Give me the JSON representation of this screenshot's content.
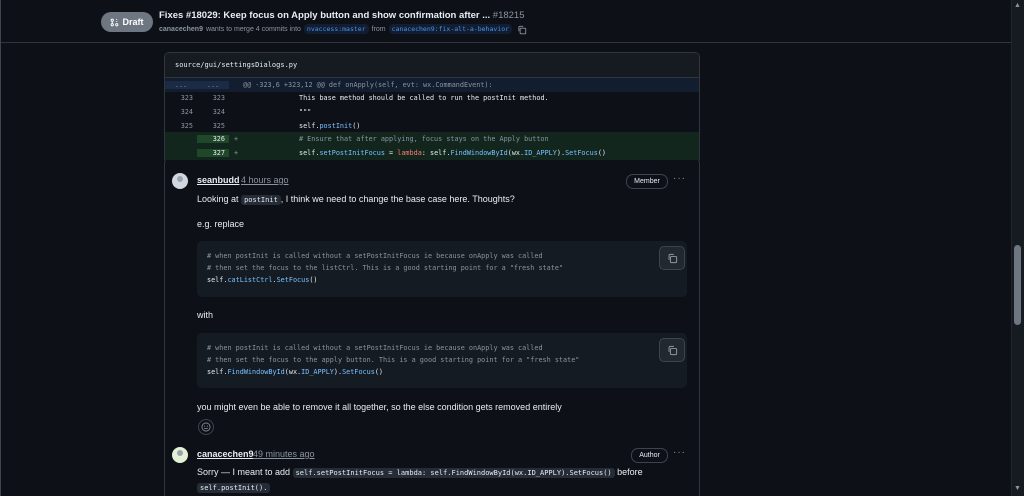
{
  "header": {
    "draft_label": "Draft",
    "title": "Fixes #18029: Keep focus on Apply button and show confirmation after ...",
    "number": "#18215",
    "author": "canacechen9",
    "merge_text": "wants to merge 4 commits into",
    "base_branch": "nvaccess:master",
    "from_text": "from",
    "head_branch": "canacechen9:fix-alt-a-behavior"
  },
  "file": {
    "path": "source/gui/settingsDialogs.py",
    "hunk": {
      "left": "...",
      "right": "...",
      "text": "@@ -323,6 +323,12 @@ def onApply(self, evt: wx.CommandEvent):"
    },
    "lines": [
      {
        "old": "323",
        "new": "323",
        "sign": "",
        "text": "\t\tThis base method should be called to run the postInit method."
      },
      {
        "old": "324",
        "new": "324",
        "sign": "",
        "text": "\t\t\"\"\""
      },
      {
        "old": "325",
        "new": "325",
        "sign": "",
        "text": "\t\tself.postInit()"
      },
      {
        "old": "",
        "new": "326",
        "sign": "+",
        "text": "\t\t# Ensure that after applying, focus stays on the Apply button"
      },
      {
        "old": "",
        "new": "327",
        "sign": "+",
        "text": "\t\tself.setPostInitFocus = lambda: self.FindWindowById(wx.ID_APPLY).SetFocus()"
      }
    ]
  },
  "comments": [
    {
      "author": "seanbudd",
      "time": "4 hours ago",
      "role": "Member",
      "p1_before": "Looking at",
      "p1_code": "postInit",
      "p1_after": ", I think we need to change the base case here. Thoughts?",
      "p2": "e.g. replace",
      "code1": [
        "# when postInit is called without a setPostInitFocus ie because onApply was called",
        "# then set the focus to the listCtrl. This is a good starting point for a \"fresh state\"",
        "self.catListCtrl.SetFocus()"
      ],
      "p3": "with",
      "code2": [
        "# when postInit is called without a setPostInitFocus ie because onApply was called",
        "# then set the focus to the apply button. This is a good starting point for a \"fresh state\"",
        "self.FindWindowById(wx.ID_APPLY).SetFocus()"
      ],
      "p4": "you might even be able to remove it all together, so the else condition gets removed entirely"
    },
    {
      "author": "canacechen9",
      "time": "49 minutes ago",
      "role": "Author",
      "p1_before": "Sorry — I meant to add",
      "p1_code": "self.setPostInitFocus = lambda: self.FindWindowById(wx.ID_APPLY).SetFocus()",
      "p1_after": "before",
      "p1_code2": "self.postInit()."
    }
  ],
  "more_label": "···",
  "colors": {
    "accent": "#4493f8",
    "add_bg": "#12261e",
    "hunk_bg": "#121d2f",
    "badge": "#6e7681"
  }
}
